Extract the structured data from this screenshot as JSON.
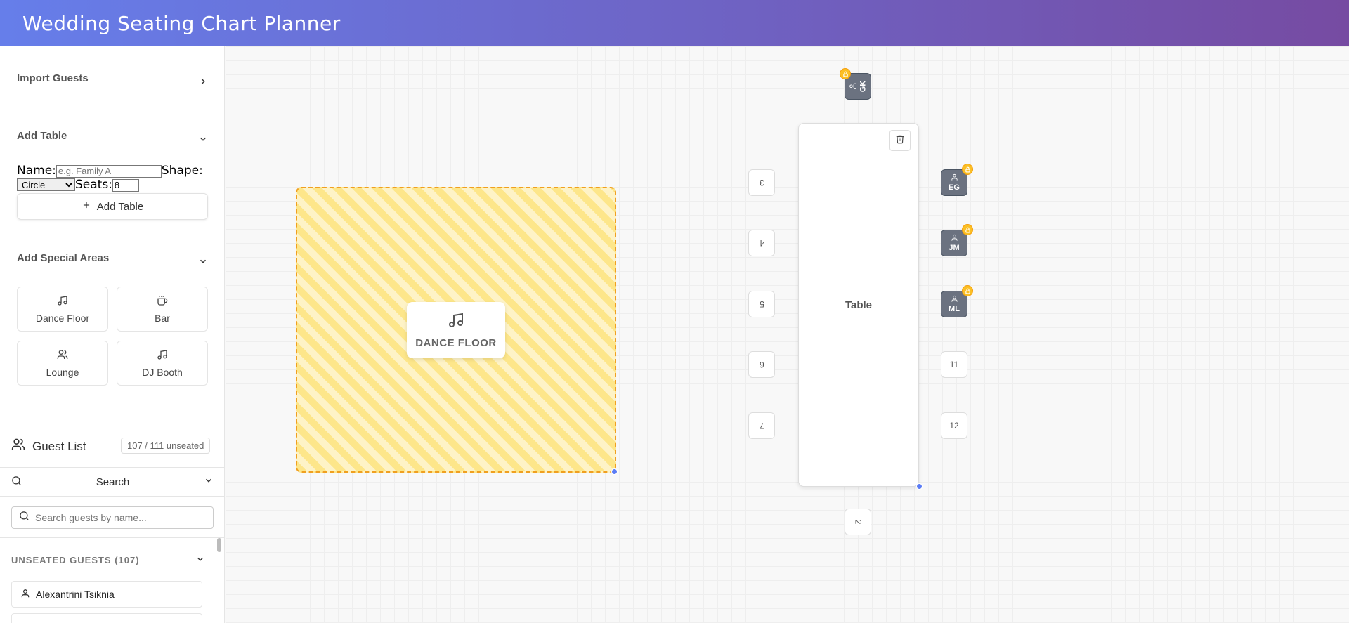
{
  "header": {
    "title": "Wedding Seating Chart Planner"
  },
  "sidebar": {
    "import_guests": "Import Guests",
    "add_table": {
      "title": "Add Table",
      "name_label": "Name:",
      "name_placeholder": "e.g. Family A",
      "shape_label": "Shape:",
      "shape_value": "Circle",
      "seats_label": "Seats:",
      "seats_value": "8",
      "button_label": "Add Table"
    },
    "special_areas": {
      "title": "Add Special Areas",
      "items": [
        {
          "label": "Dance Floor",
          "icon": "music-icon"
        },
        {
          "label": "Bar",
          "icon": "coffee-icon"
        },
        {
          "label": "Lounge",
          "icon": "users-icon"
        },
        {
          "label": "DJ Booth",
          "icon": "music-icon"
        }
      ]
    },
    "guest_list": {
      "title": "Guest List",
      "badge": "107 / 111 unseated",
      "search_label": "Search",
      "search_placeholder": "Search guests by name...",
      "unseated_title": "UNSEATED GUESTS (107)",
      "guests": [
        "Alexantrini Tsiknia"
      ]
    }
  },
  "canvas": {
    "dance_floor_label": "DANCE FLOOR",
    "table_label": "Table",
    "seats": [
      {
        "label": "2",
        "orientation": "rotated"
      },
      {
        "label": "3",
        "orientation": "flipped"
      },
      {
        "label": "4",
        "orientation": "flipped"
      },
      {
        "label": "5",
        "orientation": "flipped"
      },
      {
        "label": "6",
        "orientation": "flipped"
      },
      {
        "label": "7",
        "orientation": "flipped"
      },
      {
        "label": "11",
        "orientation": "normal"
      },
      {
        "label": "12",
        "orientation": "normal"
      }
    ],
    "occupied_seats": [
      {
        "initials": "GK",
        "locked": true
      },
      {
        "initials": "EG",
        "locked": true
      },
      {
        "initials": "JM",
        "locked": true
      },
      {
        "initials": "ML",
        "locked": true
      }
    ]
  },
  "colors": {
    "header_gradient_start": "#667eea",
    "header_gradient_end": "#764ba2",
    "dance_floor_border": "#f0a020",
    "occupied_seat": "#6b7280",
    "lock_badge": "#fbbf24"
  }
}
